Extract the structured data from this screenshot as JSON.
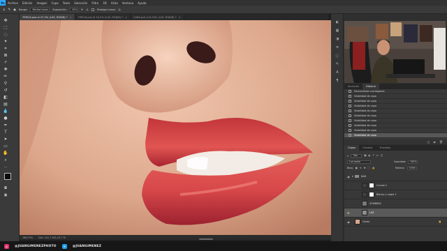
{
  "menubar": {
    "logo": "Ps",
    "items": [
      "Archivo",
      "Edición",
      "Imagen",
      "Capa",
      "Texto",
      "Selección",
      "Filtro",
      "3D",
      "Vista",
      "Ventana",
      "Ayuda"
    ]
  },
  "options": {
    "range_label": "Rango:",
    "range_value": "Medios tonos",
    "exposure_label": "Exposición:",
    "exposure_value": "10%",
    "protect_label": "Proteger tonos"
  },
  "doc_tabs": [
    {
      "label": "TERCIA.psd al 47,5% (LUZ, RGB/8) *",
      "active": true
    },
    {
      "label": "TERCIA.psd al 20,0% (LUZ, RGB/8) *",
      "active": false
    },
    {
      "label": "CARA.psd al 8,19% (LUZ, RGB/8) *",
      "active": false
    }
  ],
  "status": {
    "zoom": "166,79%",
    "doc": "Doc: 141,7 M/1,03,7 M"
  },
  "history": {
    "tabs": [
      "Acciones",
      "Historia"
    ],
    "active_tab": "Historia",
    "rows": [
      "Herramienta cuentagotas",
      "Visibilidad de capa",
      "Visibilidad de capa",
      "Visibilidad de capa",
      "Visibilidad de capa",
      "Visibilidad de capa",
      "Visibilidad de capa",
      "Visibilidad de capa",
      "Visibilidad de capa",
      "Visibilidad de capa"
    ]
  },
  "layers": {
    "tabs": [
      "Capas",
      "Canales",
      "Trazados"
    ],
    "active_tab": "Capas",
    "kind_label": "Tipo",
    "blend_mode": "Luz suave",
    "opacity_label": "Opacidad:",
    "opacity_value": "100%",
    "lock_label": "Bloq:",
    "fill_label": "Relleno:",
    "fill_value": "100%",
    "items": [
      {
        "name": "DAB",
        "type": "group",
        "selected": false
      },
      {
        "name": "Curvas 1",
        "type": "adjustment",
        "selected": false
      },
      {
        "name": "Blanco y negro 1",
        "type": "adjustment",
        "selected": false
      },
      {
        "name": "SOMBRAS",
        "type": "layer",
        "selected": false
      },
      {
        "name": "LUZ",
        "type": "layer",
        "selected": true
      },
      {
        "name": "Fondo",
        "type": "background",
        "selected": false
      }
    ]
  },
  "watermark": {
    "instagram": "@JUANGIMENEZPHOTO",
    "twitter": "@JUANGIMENEZ",
    "instagram_color": "#e1306c",
    "twitter_color": "#1da1f2"
  },
  "colors": {
    "accent": "#31a8ff"
  }
}
